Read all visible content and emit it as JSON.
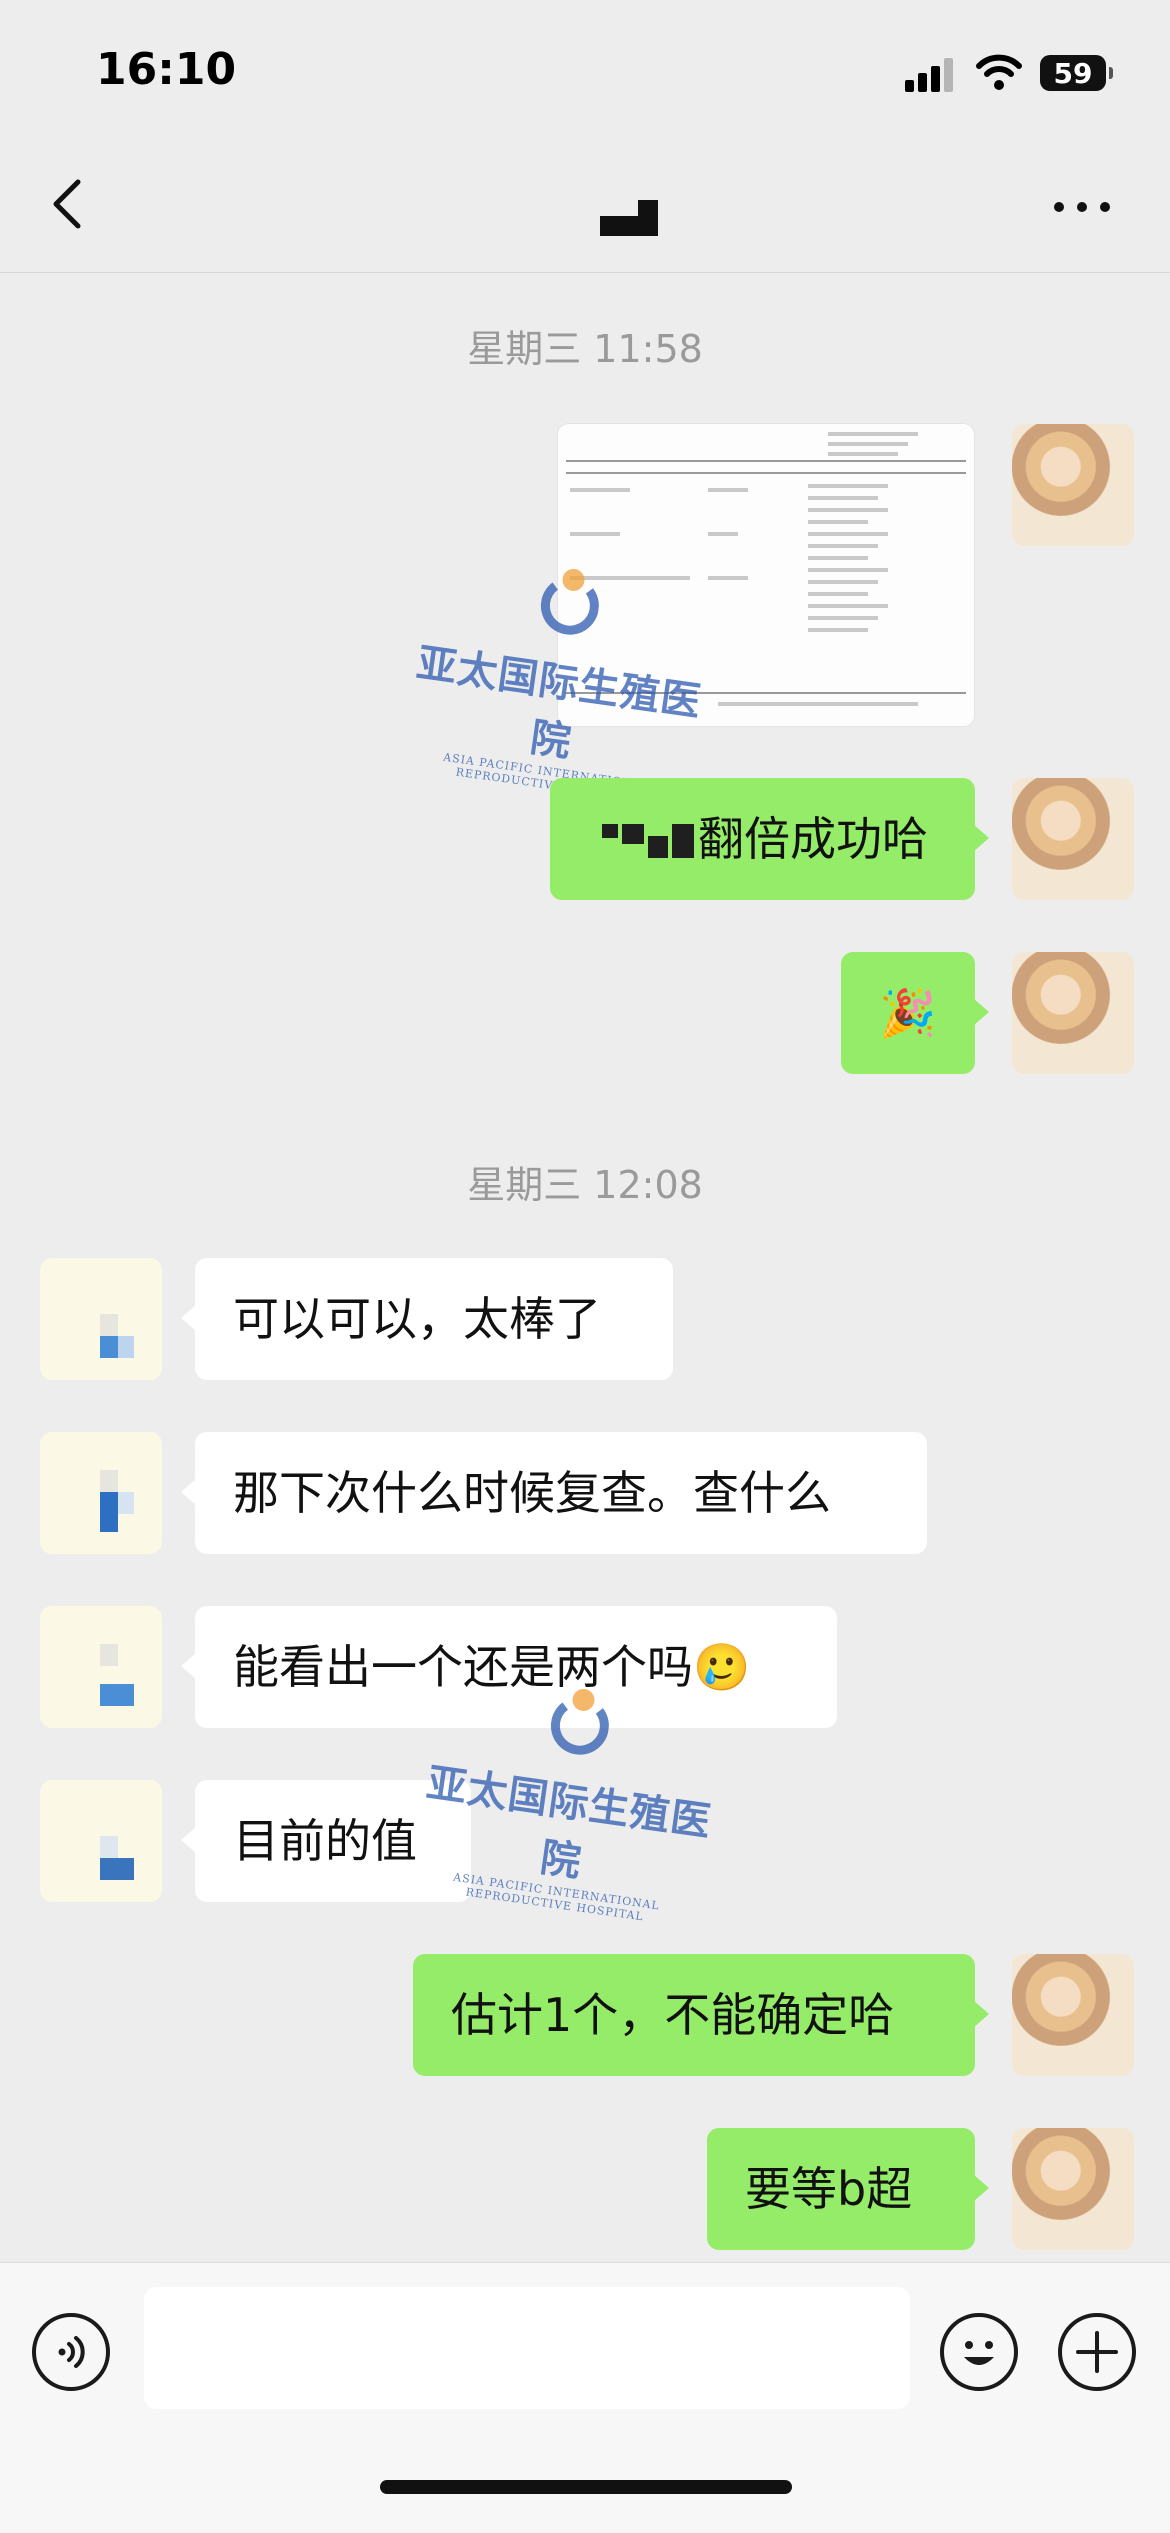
{
  "status_bar": {
    "time": "16:10",
    "battery": "59"
  },
  "nav": {
    "title_icon": "pixelated-contact-name",
    "more_icon": "more-icon",
    "back_icon": "back-icon"
  },
  "messages": {
    "ts1": "星期三 11:58",
    "out_1": "翻倍成功哈",
    "out_2_emoji": "🎉",
    "ts2": "星期三 12:08",
    "in_1": "可以可以，太棒了",
    "in_2": "那下次什么时候复查。查什么",
    "in_3": "能看出一个还是两个吗🥲",
    "in_4": "目前的值",
    "out_3": "估计1个，不能确定哈",
    "out_4": "要等b超"
  },
  "watermark": {
    "cn": "亚太国际生殖医院",
    "en": "ASIA PACIFIC INTERNATIONAL REPRODUCTIVE HOSPITAL"
  },
  "colors": {
    "outgoing_bubble": "#95ec69",
    "incoming_bubble": "#ffffff",
    "background": "#ededed",
    "watermark": "#2d5bb0"
  }
}
